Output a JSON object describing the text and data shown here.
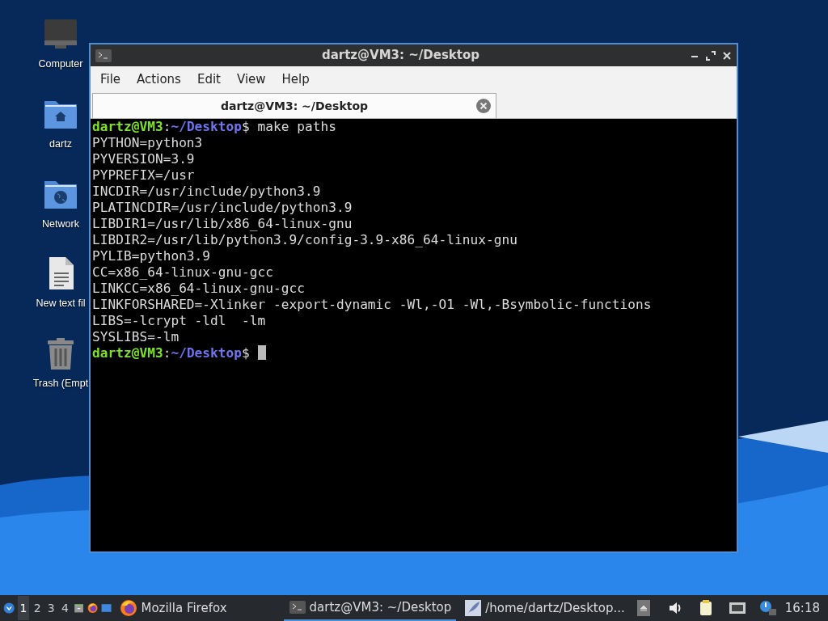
{
  "desktop_icons": [
    {
      "kind": "computer",
      "label": "Computer"
    },
    {
      "kind": "home",
      "label": "dartz"
    },
    {
      "kind": "network",
      "label": "Network"
    },
    {
      "kind": "text",
      "label": "New text fil"
    },
    {
      "kind": "trash",
      "label": "Trash (Empt"
    }
  ],
  "window": {
    "title": "dartz@VM3: ~/Desktop",
    "menu": [
      "File",
      "Actions",
      "Edit",
      "View",
      "Help"
    ],
    "tabs": [
      {
        "label": "dartz@VM3: ~/Desktop",
        "selected": true
      }
    ],
    "terminal": [
      {
        "kind": "prompt",
        "user_host": "dartz@VM3",
        "separator": ":",
        "path": "~/Desktop",
        "symbol": "$",
        "command": "make paths",
        "cursor": false
      },
      {
        "kind": "output",
        "text": "PYTHON=python3"
      },
      {
        "kind": "output",
        "text": "PYVERSION=3.9"
      },
      {
        "kind": "output",
        "text": "PYPREFIX=/usr"
      },
      {
        "kind": "output",
        "text": "INCDIR=/usr/include/python3.9"
      },
      {
        "kind": "output",
        "text": "PLATINCDIR=/usr/include/python3.9"
      },
      {
        "kind": "output",
        "text": "LIBDIR1=/usr/lib/x86_64-linux-gnu"
      },
      {
        "kind": "output",
        "text": "LIBDIR2=/usr/lib/python3.9/config-3.9-x86_64-linux-gnu"
      },
      {
        "kind": "output",
        "text": "PYLIB=python3.9"
      },
      {
        "kind": "output",
        "text": "CC=x86_64-linux-gnu-gcc"
      },
      {
        "kind": "output",
        "text": "LINKCC=x86_64-linux-gnu-gcc"
      },
      {
        "kind": "output",
        "text": "LINKFORSHARED=-Xlinker -export-dynamic -Wl,-O1 -Wl,-Bsymbolic-functions"
      },
      {
        "kind": "output",
        "text": "LIBS=-lcrypt -ldl  -lm"
      },
      {
        "kind": "output",
        "text": "SYSLIBS=-lm"
      },
      {
        "kind": "prompt",
        "user_host": "dartz@VM3",
        "separator": ":",
        "path": "~/Desktop",
        "symbol": "$",
        "cursor": true
      }
    ]
  },
  "taskbar": {
    "workspaces": [
      {
        "label": "1",
        "selected": true
      },
      {
        "label": "2",
        "selected": false
      },
      {
        "label": "3",
        "selected": false
      },
      {
        "label": "4",
        "selected": false
      }
    ],
    "launchers": [
      {
        "kind": "files"
      },
      {
        "kind": "firefox"
      },
      {
        "kind": "desktop"
      }
    ],
    "tasks": [
      {
        "kind": "firefox",
        "label": "Mozilla Firefox",
        "selected": false
      },
      {
        "kind": "terminal",
        "label": "dartz@VM3: ~/Desktop",
        "selected": true
      },
      {
        "kind": "editor",
        "label": "/home/dartz/Desktop..."
      }
    ],
    "tray": [
      {
        "kind": "eject"
      },
      {
        "kind": "volume"
      },
      {
        "kind": "clipboard"
      },
      {
        "kind": "network"
      },
      {
        "kind": "update"
      }
    ],
    "clock": "16:18"
  }
}
